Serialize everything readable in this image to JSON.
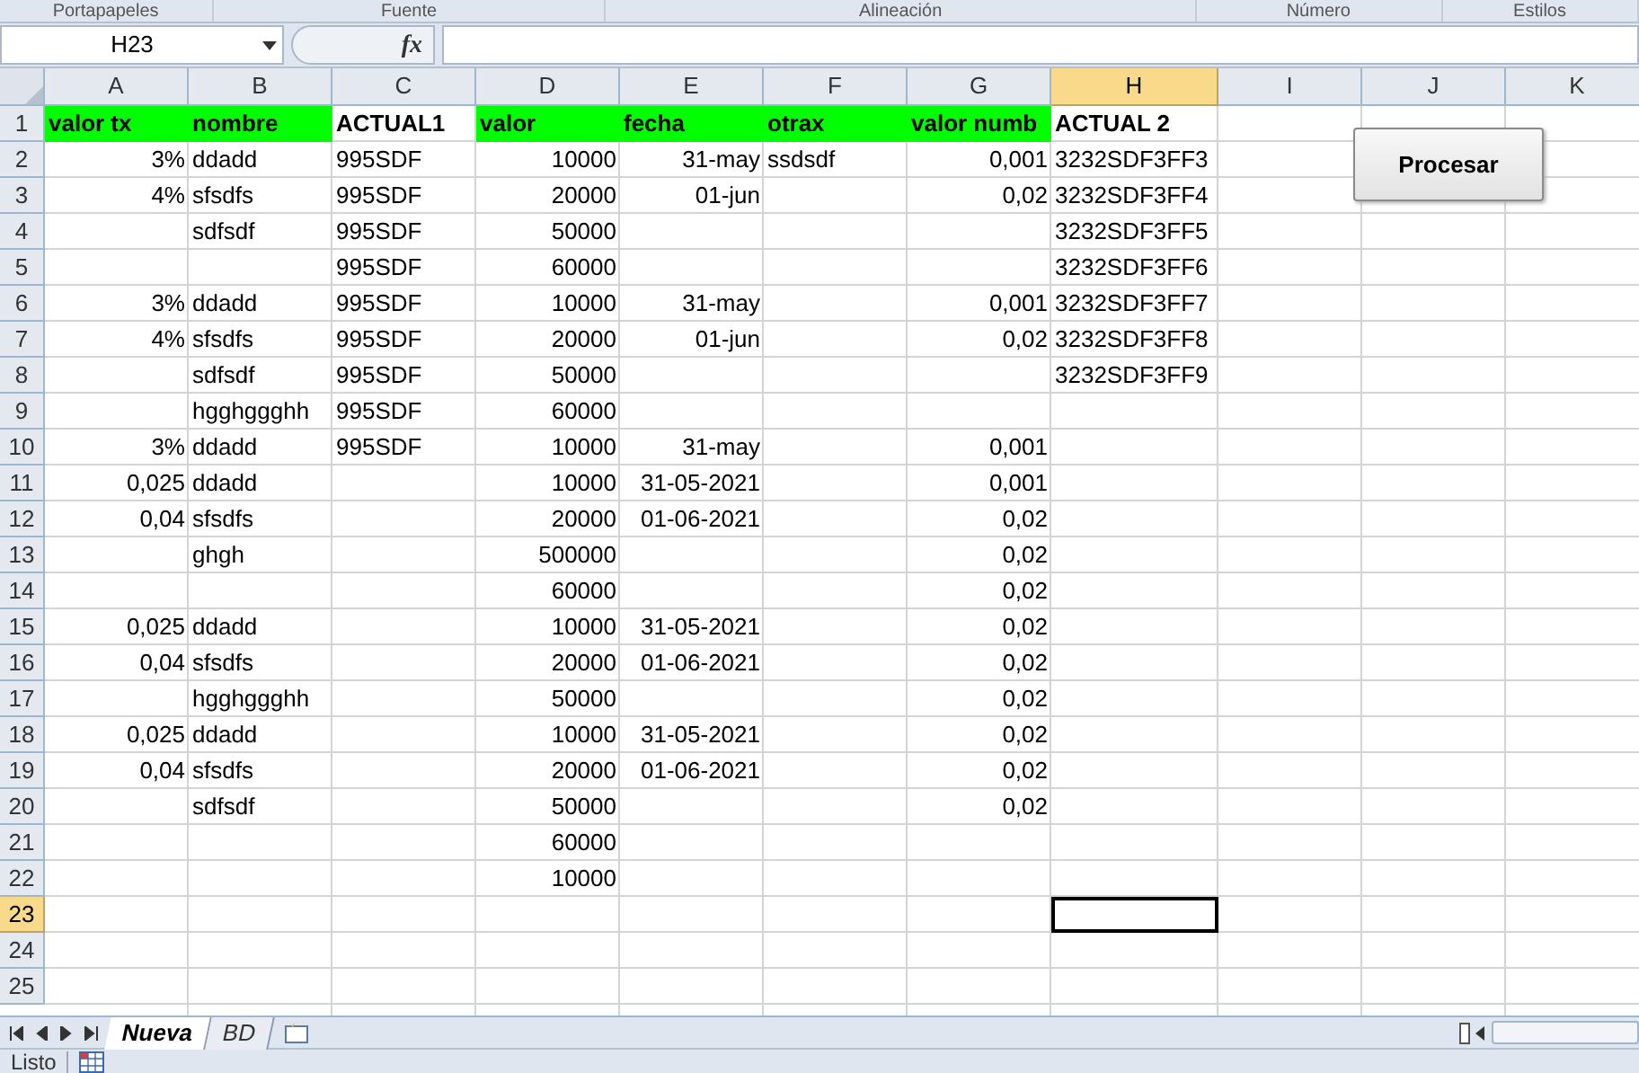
{
  "ribbon_groups": [
    "Portapapeles",
    "Fuente",
    "Alineación",
    "Número",
    "Estilos"
  ],
  "formula_bar": {
    "name_box": "H23",
    "function_label": "fx"
  },
  "columns": [
    {
      "label": "A",
      "selected": false
    },
    {
      "label": "B",
      "selected": false
    },
    {
      "label": "C",
      "selected": false
    },
    {
      "label": "D",
      "selected": false
    },
    {
      "label": "E",
      "selected": false
    },
    {
      "label": "F",
      "selected": false
    },
    {
      "label": "G",
      "selected": false
    },
    {
      "label": "H",
      "selected": true
    },
    {
      "label": "I",
      "selected": false
    },
    {
      "label": "J",
      "selected": false
    },
    {
      "label": "K",
      "selected": false
    }
  ],
  "header_row": {
    "number": "1",
    "cells": [
      {
        "text": "valor tx",
        "highlighted": true
      },
      {
        "text": "nombre",
        "highlighted": true
      },
      {
        "text": "ACTUAL1",
        "highlighted": false
      },
      {
        "text": "valor",
        "highlighted": true
      },
      {
        "text": "fecha",
        "highlighted": true
      },
      {
        "text": "otrax",
        "highlighted": true
      },
      {
        "text": "valor numb",
        "highlighted": true
      },
      {
        "text": "ACTUAL 2",
        "highlighted": false
      }
    ]
  },
  "rows": [
    {
      "number": "2",
      "selected": false,
      "cells": [
        "3%",
        "ddadd",
        "995SDF",
        "10000",
        "31-may",
        "ssdsdf",
        "0,001",
        "3232SDF3FF3"
      ]
    },
    {
      "number": "3",
      "selected": false,
      "cells": [
        "4%",
        "sfsdfs",
        "995SDF",
        "20000",
        "01-jun",
        "",
        "0,02",
        "3232SDF3FF4"
      ]
    },
    {
      "number": "4",
      "selected": false,
      "cells": [
        "",
        "sdfsdf",
        "995SDF",
        "50000",
        "",
        "",
        "",
        "3232SDF3FF5"
      ]
    },
    {
      "number": "5",
      "selected": false,
      "cells": [
        "",
        "",
        "995SDF",
        "60000",
        "",
        "",
        "",
        "3232SDF3FF6"
      ]
    },
    {
      "number": "6",
      "selected": false,
      "cells": [
        "3%",
        "ddadd",
        "995SDF",
        "10000",
        "31-may",
        "",
        "0,001",
        "3232SDF3FF7"
      ]
    },
    {
      "number": "7",
      "selected": false,
      "cells": [
        "4%",
        "sfsdfs",
        "995SDF",
        "20000",
        "01-jun",
        "",
        "0,02",
        "3232SDF3FF8"
      ]
    },
    {
      "number": "8",
      "selected": false,
      "cells": [
        "",
        "sdfsdf",
        "995SDF",
        "50000",
        "",
        "",
        "",
        "3232SDF3FF9"
      ]
    },
    {
      "number": "9",
      "selected": false,
      "cells": [
        "",
        "hgghggghh",
        "995SDF",
        "60000",
        "",
        "",
        "",
        ""
      ]
    },
    {
      "number": "10",
      "selected": false,
      "cells": [
        "3%",
        "ddadd",
        "995SDF",
        "10000",
        "31-may",
        "",
        "0,001",
        ""
      ]
    },
    {
      "number": "11",
      "selected": false,
      "cells": [
        "0,025",
        "ddadd",
        "",
        "10000",
        "31-05-2021",
        "",
        "0,001",
        ""
      ]
    },
    {
      "number": "12",
      "selected": false,
      "cells": [
        "0,04",
        "sfsdfs",
        "",
        "20000",
        "01-06-2021",
        "",
        "0,02",
        ""
      ]
    },
    {
      "number": "13",
      "selected": false,
      "cells": [
        "",
        "ghgh",
        "",
        "500000",
        "",
        "",
        "0,02",
        ""
      ]
    },
    {
      "number": "14",
      "selected": false,
      "cells": [
        "",
        "",
        "",
        "60000",
        "",
        "",
        "0,02",
        ""
      ]
    },
    {
      "number": "15",
      "selected": false,
      "cells": [
        "0,025",
        "ddadd",
        "",
        "10000",
        "31-05-2021",
        "",
        "0,02",
        ""
      ]
    },
    {
      "number": "16",
      "selected": false,
      "cells": [
        "0,04",
        "sfsdfs",
        "",
        "20000",
        "01-06-2021",
        "",
        "0,02",
        ""
      ]
    },
    {
      "number": "17",
      "selected": false,
      "cells": [
        "",
        "hgghggghh",
        "",
        "50000",
        "",
        "",
        "0,02",
        ""
      ]
    },
    {
      "number": "18",
      "selected": false,
      "cells": [
        "0,025",
        "ddadd",
        "",
        "10000",
        "31-05-2021",
        "",
        "0,02",
        ""
      ]
    },
    {
      "number": "19",
      "selected": false,
      "cells": [
        "0,04",
        "sfsdfs",
        "",
        "20000",
        "01-06-2021",
        "",
        "0,02",
        ""
      ]
    },
    {
      "number": "20",
      "selected": false,
      "cells": [
        "",
        "sdfsdf",
        "",
        "50000",
        "",
        "",
        "0,02",
        ""
      ]
    },
    {
      "number": "21",
      "selected": false,
      "cells": [
        "",
        "",
        "",
        "60000",
        "",
        "",
        "",
        ""
      ]
    },
    {
      "number": "22",
      "selected": false,
      "cells": [
        "",
        "",
        "",
        "10000",
        "",
        "",
        "",
        ""
      ]
    },
    {
      "number": "23",
      "selected": true,
      "cells": []
    },
    {
      "number": "24",
      "selected": false,
      "cells": []
    },
    {
      "number": "25",
      "selected": false,
      "cells": []
    }
  ],
  "button": {
    "label": "Procesar"
  },
  "sheet_tabs": [
    {
      "label": "Nueva",
      "selected": true
    },
    {
      "label": "BD",
      "selected": false
    }
  ],
  "status_bar": {
    "text": "Listo"
  }
}
